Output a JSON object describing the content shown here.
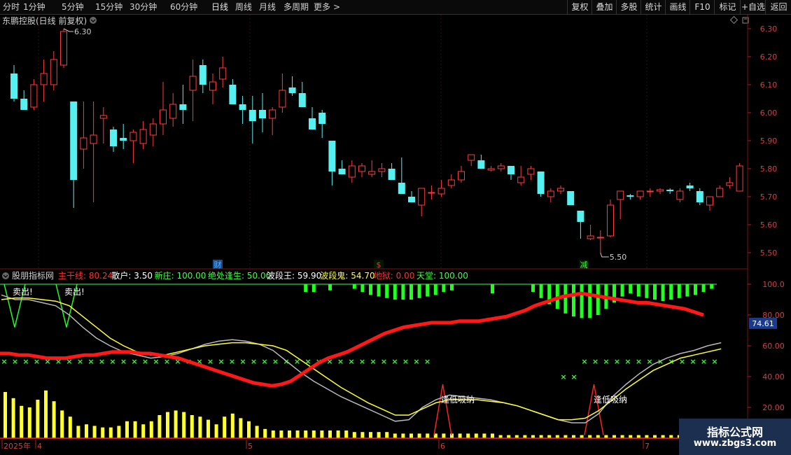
{
  "toolbar": {
    "periods": [
      "分时",
      "1分钟",
      "5分钟",
      "15分钟",
      "30分钟",
      "60分钟",
      "日线",
      "周线",
      "月线",
      "多周期",
      "更多"
    ],
    "active_period": "日线",
    "more_chevron": ">",
    "right_buttons": [
      "复权",
      "叠加",
      "多股",
      "统计",
      "画线",
      "F10",
      "标记",
      "+自选",
      "返回"
    ]
  },
  "main": {
    "title": "东鹏控股(日线 前复权)",
    "high_label": "6.30",
    "low_label": "5.50",
    "price_ticks": [
      "6.30",
      "6.20",
      "6.10",
      "6.00",
      "5.90",
      "5.80",
      "5.70",
      "5.60",
      "5.50"
    ],
    "events": [
      {
        "label": "财",
        "color": "#4fb3ff"
      },
      {
        "label": "$",
        "color": "#ff3030"
      },
      {
        "label": "减",
        "color": "#40ff40"
      }
    ],
    "candles": [
      [
        6.14,
        6.17,
        6.04,
        6.05
      ],
      [
        6.05,
        6.08,
        6.01,
        6.01
      ],
      [
        6.02,
        6.12,
        6.01,
        6.1
      ],
      [
        6.1,
        6.19,
        6.04,
        6.14
      ],
      [
        6.1,
        6.22,
        6.08,
        6.19
      ],
      [
        6.17,
        6.3,
        6.16,
        6.29
      ],
      [
        6.04,
        6.0,
        5.66,
        5.76
      ],
      [
        5.87,
        6.04,
        5.8,
        5.91
      ],
      [
        5.89,
        6.04,
        5.68,
        5.92
      ],
      [
        5.98,
        6.02,
        5.89,
        5.99
      ],
      [
        5.94,
        5.95,
        5.86,
        5.88
      ],
      [
        5.91,
        5.96,
        5.87,
        5.9
      ],
      [
        5.9,
        5.94,
        5.82,
        5.93
      ],
      [
        5.89,
        5.97,
        5.87,
        5.94
      ],
      [
        5.92,
        5.98,
        5.88,
        5.96
      ],
      [
        5.96,
        6.11,
        5.92,
        6.01
      ],
      [
        5.98,
        6.07,
        5.95,
        6.03
      ],
      [
        6.03,
        6.1,
        5.96,
        6.01
      ],
      [
        6.08,
        6.19,
        5.97,
        6.13
      ],
      [
        6.17,
        6.19,
        6.07,
        6.1
      ],
      [
        6.08,
        6.14,
        6.03,
        6.11
      ],
      [
        6.12,
        6.2,
        6.09,
        6.16
      ],
      [
        6.1,
        6.12,
        6.04,
        6.03
      ],
      [
        6.03,
        6.06,
        5.96,
        6.01
      ],
      [
        6.01,
        6.06,
        5.89,
        5.97
      ],
      [
        6.01,
        6.07,
        5.93,
        5.98
      ],
      [
        5.98,
        6.02,
        5.92,
        6.01
      ],
      [
        6.02,
        6.14,
        6.0,
        6.08
      ],
      [
        6.09,
        6.13,
        6.06,
        6.07
      ],
      [
        6.07,
        6.11,
        6.05,
        6.02
      ],
      [
        5.98,
        6.02,
        5.94,
        5.94
      ],
      [
        6.0,
        6.01,
        5.91,
        5.96
      ],
      [
        5.9,
        5.9,
        5.74,
        5.79
      ],
      [
        5.8,
        5.83,
        5.78,
        5.78
      ],
      [
        5.77,
        5.83,
        5.75,
        5.81
      ],
      [
        5.79,
        5.82,
        5.77,
        5.81
      ],
      [
        5.78,
        5.83,
        5.77,
        5.79
      ],
      [
        5.79,
        5.82,
        5.77,
        5.8
      ],
      [
        5.8,
        5.82,
        5.76,
        5.76
      ],
      [
        5.75,
        5.84,
        5.71,
        5.71
      ],
      [
        5.7,
        5.72,
        5.68,
        5.68
      ],
      [
        5.67,
        5.73,
        5.63,
        5.73
      ],
      [
        5.715,
        5.74,
        5.69,
        5.715
      ],
      [
        5.71,
        5.76,
        5.7,
        5.73
      ],
      [
        5.74,
        5.78,
        5.73,
        5.76
      ],
      [
        5.76,
        5.81,
        5.75,
        5.79
      ],
      [
        5.83,
        5.85,
        5.81,
        5.85
      ],
      [
        5.83,
        5.85,
        5.8,
        5.8
      ],
      [
        5.795,
        5.81,
        5.79,
        5.8
      ],
      [
        5.8,
        5.82,
        5.79,
        5.81
      ],
      [
        5.81,
        5.81,
        5.76,
        5.78
      ],
      [
        5.75,
        5.81,
        5.74,
        5.77
      ],
      [
        5.78,
        5.81,
        5.76,
        5.8
      ],
      [
        5.79,
        5.79,
        5.7,
        5.71
      ],
      [
        5.7,
        5.73,
        5.68,
        5.72
      ],
      [
        5.72,
        5.74,
        5.71,
        5.73
      ],
      [
        5.72,
        5.72,
        5.7,
        5.67
      ],
      [
        5.65,
        5.65,
        5.55,
        5.61
      ],
      [
        5.55,
        5.6,
        5.545,
        5.56
      ],
      [
        5.555,
        5.58,
        5.5,
        5.555
      ],
      [
        5.56,
        5.69,
        5.555,
        5.67
      ],
      [
        5.69,
        5.72,
        5.62,
        5.72
      ],
      [
        5.705,
        5.71,
        5.69,
        5.7
      ],
      [
        5.7,
        5.72,
        5.69,
        5.72
      ],
      [
        5.72,
        5.73,
        5.7,
        5.72
      ],
      [
        5.72,
        5.73,
        5.71,
        5.725
      ],
      [
        5.725,
        5.73,
        5.71,
        5.72
      ],
      [
        5.69,
        5.73,
        5.68,
        5.72
      ],
      [
        5.74,
        5.75,
        5.72,
        5.73
      ],
      [
        5.72,
        5.73,
        5.67,
        5.68
      ],
      [
        5.67,
        5.69,
        5.65,
        5.7
      ],
      [
        5.7,
        5.74,
        5.7,
        5.73
      ],
      [
        5.74,
        5.77,
        5.73,
        5.75
      ],
      [
        5.72,
        5.82,
        5.72,
        5.81
      ]
    ]
  },
  "indicator": {
    "name": "股朋指标网",
    "values": [
      {
        "label": "主干线:",
        "value": "80.24",
        "color": "#ff3030"
      },
      {
        "label": "散户:",
        "value": "3.50",
        "color": "#ffffff"
      },
      {
        "label": "新庄:",
        "value": "100.00",
        "color": "#40ff40"
      },
      {
        "label": "绝处逢生:",
        "value": "50.00",
        "color": "#40ff40"
      },
      {
        "label": "波段王:",
        "value": "59.90",
        "color": "#ffffff"
      },
      {
        "label": "波段鬼:",
        "value": "54.70",
        "color": "#ffff40"
      },
      {
        "label": "地狱:",
        "value": "0.00",
        "color": "#ff3030"
      },
      {
        "label": "天堂:",
        "value": "100.00",
        "color": "#40ff40"
      }
    ],
    "ticks": [
      "100.0",
      "80.00",
      "60.00",
      "40.00",
      "20.00"
    ],
    "current_value": "74.61",
    "sell_label": "卖出!",
    "buy_label": "逢低吸纳",
    "main_line": [
      55,
      55,
      54,
      54,
      53,
      52,
      52,
      52,
      53,
      54,
      54,
      55,
      56,
      56,
      56,
      55,
      55,
      54,
      53,
      52,
      50,
      48,
      46,
      44,
      42,
      40,
      38,
      36,
      35,
      34,
      35,
      37,
      41,
      45,
      49,
      52,
      54,
      56,
      59,
      62,
      65,
      68,
      70,
      72,
      73,
      74,
      75,
      75,
      75,
      76,
      76,
      76,
      77,
      78,
      79,
      81,
      83,
      86,
      88,
      90,
      92,
      93,
      94,
      93,
      92,
      91,
      90,
      89,
      88,
      88,
      87,
      86,
      85,
      84,
      82,
      80
    ],
    "white_line": [
      93,
      90,
      90,
      88,
      86,
      80,
      72,
      65,
      60,
      56,
      54,
      52,
      53,
      55,
      58,
      61,
      63,
      64,
      63,
      61,
      57,
      50,
      43,
      37,
      32,
      27,
      23,
      19,
      15,
      11,
      12,
      20,
      25,
      28,
      27,
      26,
      25,
      23,
      21,
      18,
      15,
      12,
      10,
      10,
      16,
      27,
      35,
      42,
      48,
      52,
      55,
      57,
      60,
      62
    ],
    "yellow_line": [
      90,
      91,
      91,
      90,
      89,
      86,
      79,
      72,
      65,
      60,
      56,
      54,
      54,
      56,
      58,
      60,
      61,
      62,
      62,
      61,
      60,
      57,
      51,
      45,
      39,
      33,
      28,
      23,
      19,
      15,
      15,
      19,
      23,
      25,
      25,
      25,
      24,
      23,
      21,
      18,
      15,
      12,
      12,
      13,
      18,
      25,
      32,
      38,
      44,
      48,
      52,
      54,
      56,
      58
    ],
    "green_bars": [
      0,
      0,
      0,
      0,
      0,
      0,
      0,
      0,
      0,
      0,
      0,
      0,
      0,
      0,
      0,
      0,
      0,
      0,
      0,
      0,
      0,
      0,
      0,
      0,
      0,
      0,
      0,
      0,
      0,
      0,
      0,
      0,
      0,
      0,
      0,
      0,
      0,
      5,
      5,
      0,
      4,
      0,
      0,
      3,
      5,
      7,
      8,
      9,
      10,
      10,
      10,
      9,
      8,
      7,
      5,
      4,
      0,
      0,
      0,
      0,
      6,
      0,
      0,
      0,
      0,
      5,
      9,
      13,
      16,
      19,
      21,
      22,
      22,
      20,
      16,
      12,
      8,
      6,
      8,
      9,
      10,
      11,
      10,
      9,
      8,
      7,
      5,
      3,
      0
    ],
    "yellow_bars": [
      30,
      26,
      21,
      20,
      25,
      31,
      24,
      18,
      14,
      8,
      9,
      8,
      7,
      7,
      8,
      11,
      11,
      9,
      11,
      15,
      17,
      18,
      17,
      15,
      14,
      12,
      9,
      14,
      16,
      13,
      11,
      8,
      6,
      5,
      5,
      5,
      5,
      5,
      5,
      5,
      5,
      5,
      5,
      4,
      4,
      4,
      4,
      4,
      3,
      3,
      3,
      3,
      3,
      3,
      3,
      3,
      3,
      3,
      3,
      3,
      3,
      2,
      2,
      2,
      2,
      2,
      2,
      2,
      2,
      2,
      2,
      2,
      2,
      2,
      2,
      2,
      2,
      2,
      2,
      2,
      2,
      2,
      2,
      2,
      2,
      2,
      2,
      2
    ]
  },
  "x_axis": {
    "labels": [
      "2025年",
      "4",
      "5",
      "6",
      "7"
    ]
  },
  "watermark": {
    "title": "指标公式网",
    "url": "www.zbgs3.com"
  }
}
